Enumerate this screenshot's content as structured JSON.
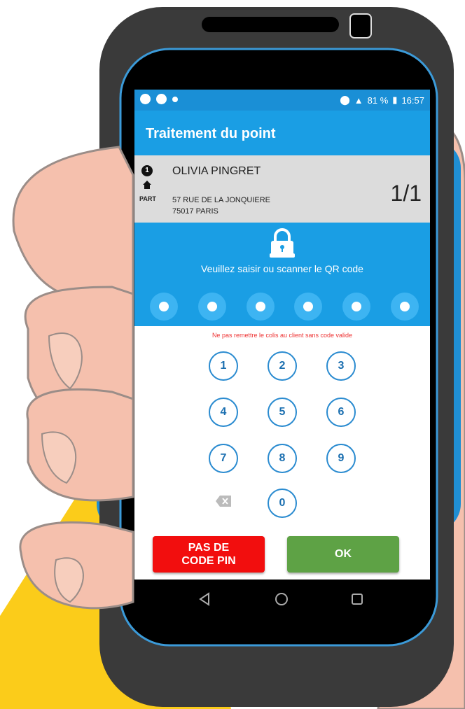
{
  "status_bar": {
    "battery_percent": "81 %",
    "time": "16:57"
  },
  "app_bar": {
    "title": "Traitement du point"
  },
  "delivery": {
    "stop_number": "1",
    "type_label": "PART",
    "client_name": "OLIVIA PINGRET",
    "address_line1": "57 RUE DE LA JONQUIERE",
    "address_line2": "75017 PARIS",
    "progress": "1/1"
  },
  "qr_panel": {
    "instruction": "Veuillez saisir ou scanner le QR code",
    "pin_length": 6,
    "warning": "Ne pas remettre le colis au client sans code valide"
  },
  "keypad": {
    "keys": [
      "1",
      "2",
      "3",
      "4",
      "5",
      "6",
      "7",
      "8",
      "9",
      "0"
    ]
  },
  "buttons": {
    "no_pin_line1": "PAS DE",
    "no_pin_line2": "CODE PIN",
    "ok": "OK"
  },
  "colors": {
    "primary_blue": "#1a9ee4",
    "no_pin_red": "#f20e0e",
    "ok_green": "#5ea245",
    "warning_red": "#ee3333"
  },
  "icons": [
    "home-icon",
    "lock-icon",
    "backspace-icon",
    "back-nav-icon",
    "home-nav-icon",
    "recents-nav-icon"
  ]
}
